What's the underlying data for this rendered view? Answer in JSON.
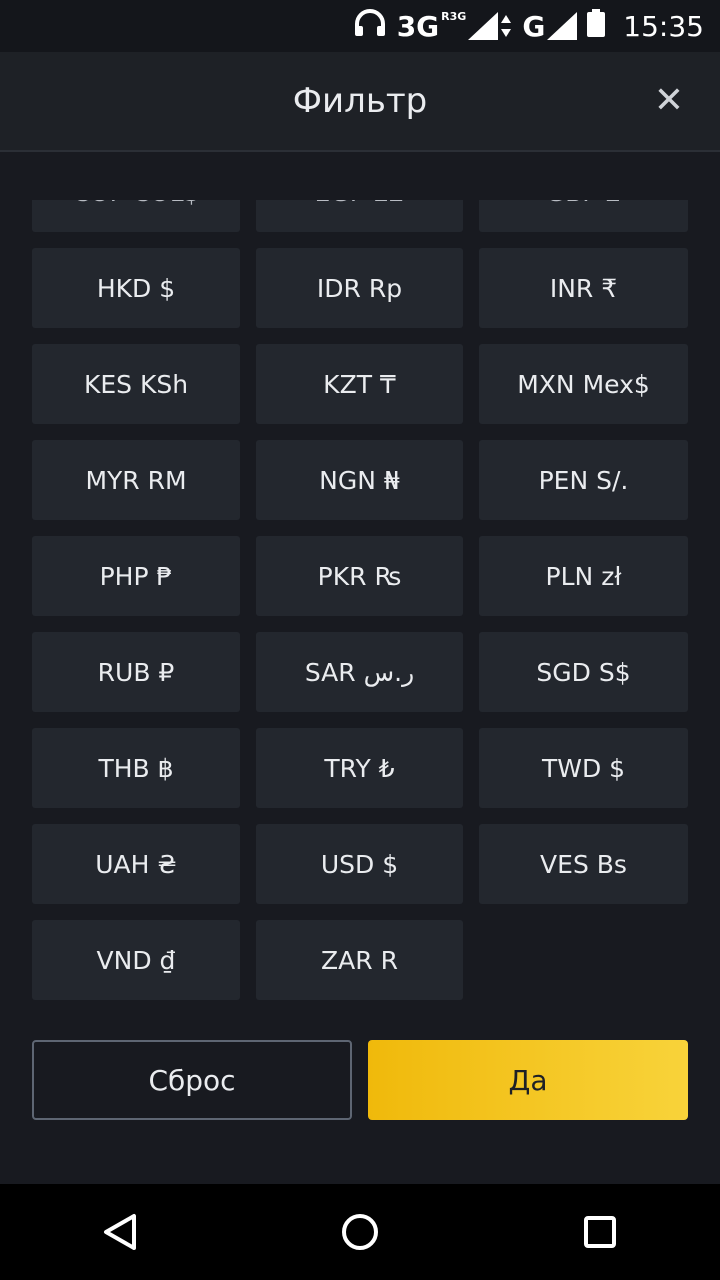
{
  "status_bar": {
    "net1": "3G",
    "net1_sup": "R3G",
    "net2": "G",
    "time": "15:35",
    "icons": [
      "headphones-icon",
      "signal-icon",
      "data-arrows-icon",
      "signal-icon",
      "battery-icon"
    ]
  },
  "header": {
    "title": "Фильтр",
    "close": "✕"
  },
  "currencies": {
    "partial_row": [
      "COP COL$",
      "EGP E£",
      "GBP £"
    ],
    "rows": [
      [
        "HKD $",
        "IDR Rp",
        "INR ₹"
      ],
      [
        "KES KSh",
        "KZT ₸",
        "MXN Mex$"
      ],
      [
        "MYR RM",
        "NGN ₦",
        "PEN S/."
      ],
      [
        "PHP ₱",
        "PKR ₨",
        "PLN zł"
      ],
      [
        "RUB ₽",
        "SAR ر.س",
        "SGD S$"
      ],
      [
        "THB ฿",
        "TRY ₺",
        "TWD  $"
      ],
      [
        "UAH ₴",
        "USD $",
        "VES Bs"
      ],
      [
        "VND ₫",
        "ZAR R"
      ]
    ]
  },
  "buttons": {
    "reset": "Сброс",
    "ok": "Да"
  },
  "colors": {
    "accent": "#f0b90b",
    "background": "#181a20",
    "cell": "#23272e"
  }
}
